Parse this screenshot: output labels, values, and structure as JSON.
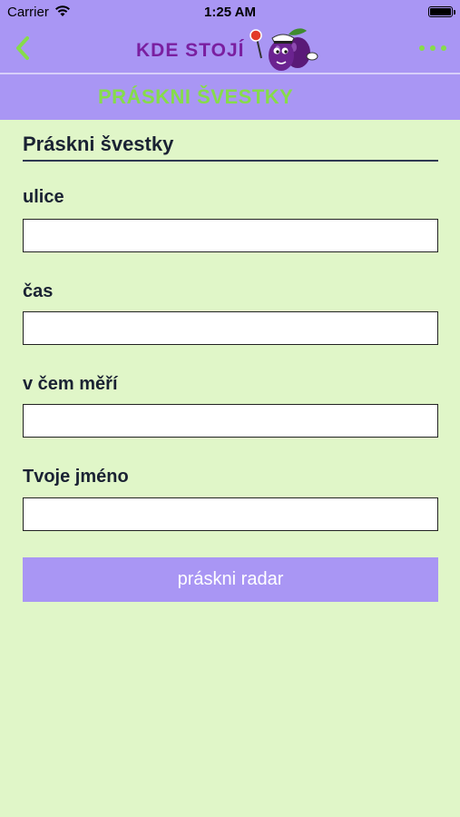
{
  "status_bar": {
    "carrier": "Carrier",
    "time": "1:25 AM"
  },
  "nav": {
    "logo_text": "KDE STOJÍ"
  },
  "subheader": {
    "title": "PRÁSKNI ŠVESTKY"
  },
  "form": {
    "title": "Práskni švestky",
    "fields": [
      {
        "label": "ulice",
        "value": ""
      },
      {
        "label": "čas",
        "value": ""
      },
      {
        "label": "v čem měří",
        "value": ""
      },
      {
        "label": "Tvoje jméno",
        "value": ""
      }
    ],
    "submit_label": "práskni radar"
  },
  "colors": {
    "header_bg": "#a996f4",
    "page_bg": "#e0f6c8",
    "accent_green": "#86dc4a",
    "logo_purple": "#7a1fa0"
  },
  "icons": [
    "back-chevron-icon",
    "wifi-icon",
    "battery-icon",
    "more-dots-icon",
    "plum-mascot-logo"
  ]
}
